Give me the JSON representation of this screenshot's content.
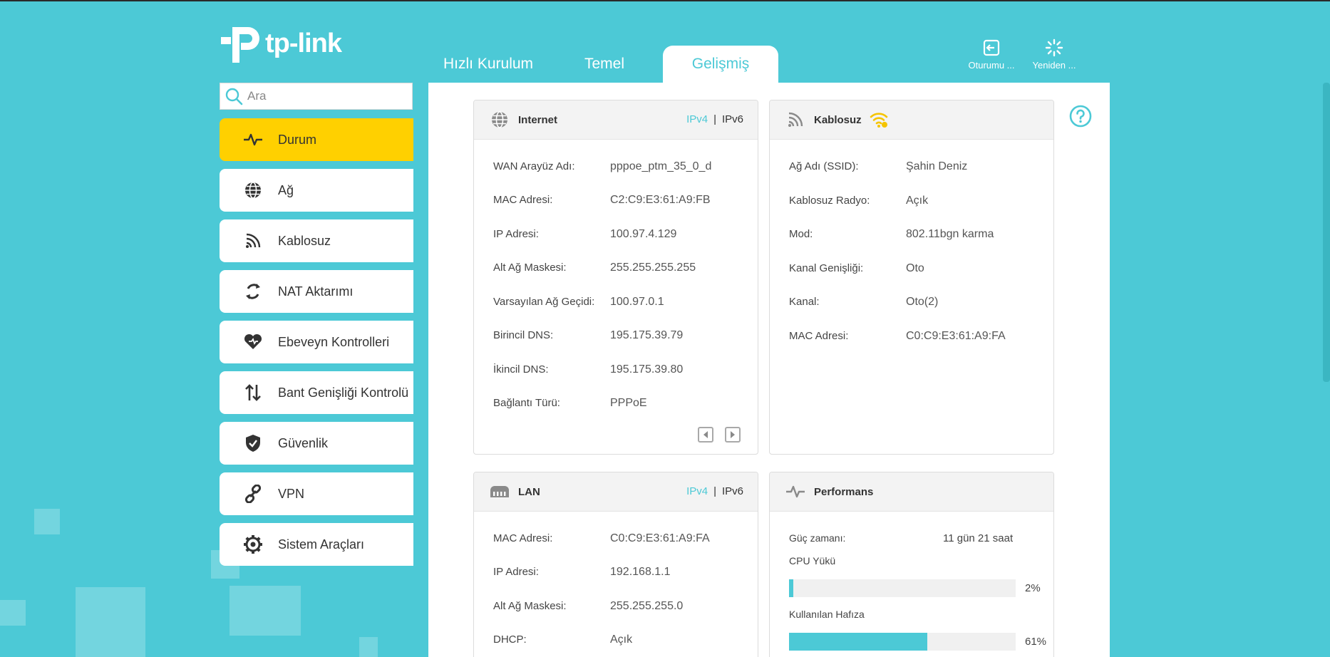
{
  "brand": {
    "logo_text": "tp-link"
  },
  "tabs": [
    {
      "label": "Hızlı Kurulum"
    },
    {
      "label": "Temel"
    },
    {
      "label": "Gelişmiş"
    }
  ],
  "top_actions": {
    "logout": {
      "label": "Oturumu ...",
      "icon": "logout-icon"
    },
    "reboot": {
      "label": "Yeniden ...",
      "icon": "reboot-icon"
    }
  },
  "search": {
    "placeholder": "Ara"
  },
  "sidebar": {
    "items": [
      {
        "label": "Durum",
        "icon": "pulse-icon"
      },
      {
        "label": "Ağ",
        "icon": "globe-icon"
      },
      {
        "label": "Kablosuz",
        "icon": "wireless-icon"
      },
      {
        "label": "NAT Aktarımı",
        "icon": "nat-icon"
      },
      {
        "label": "Ebeveyn Kontrolleri",
        "icon": "heart-icon"
      },
      {
        "label": "Bant Genişliği Kontrolü",
        "icon": "bandwidth-icon"
      },
      {
        "label": "Güvenlik",
        "icon": "shield-icon"
      },
      {
        "label": "VPN",
        "icon": "link-icon"
      },
      {
        "label": "Sistem Araçları",
        "icon": "gear-icon"
      }
    ]
  },
  "internet": {
    "title": "Internet",
    "ipv4": "IPv4",
    "sep": "|",
    "ipv6": "IPv6",
    "rows": [
      {
        "k": "WAN Arayüz Adı:",
        "v": "pppoe_ptm_35_0_d"
      },
      {
        "k": "MAC Adresi:",
        "v": "C2:C9:E3:61:A9:FB"
      },
      {
        "k": "IP Adresi:",
        "v": "100.97.4.129"
      },
      {
        "k": "Alt Ağ Maskesi:",
        "v": "255.255.255.255"
      },
      {
        "k": "Varsayılan Ağ Geçidi:",
        "v": "100.97.0.1"
      },
      {
        "k": "Birincil DNS:",
        "v": "195.175.39.79"
      },
      {
        "k": "İkincil DNS:",
        "v": "195.175.39.80"
      },
      {
        "k": "Bağlantı Türü:",
        "v": "PPPoE"
      }
    ]
  },
  "wireless": {
    "title": "Kablosuz",
    "rows": [
      {
        "k": "Ağ Adı (SSID):",
        "v": "Şahin Deniz"
      },
      {
        "k": "Kablosuz Radyo:",
        "v": "Açık"
      },
      {
        "k": "Mod:",
        "v": "802.11bgn karma"
      },
      {
        "k": "Kanal Genişliği:",
        "v": "Oto"
      },
      {
        "k": "Kanal:",
        "v": "Oto(2)"
      },
      {
        "k": "MAC Adresi:",
        "v": "C0:C9:E3:61:A9:FA"
      }
    ]
  },
  "lan": {
    "title": "LAN",
    "ipv4": "IPv4",
    "sep": "|",
    "ipv6": "IPv6",
    "rows": [
      {
        "k": "MAC Adresi:",
        "v": "C0:C9:E3:61:A9:FA"
      },
      {
        "k": "IP Adresi:",
        "v": "192.168.1.1"
      },
      {
        "k": "Alt Ağ Maskesi:",
        "v": "255.255.255.0"
      },
      {
        "k": "DHCP:",
        "v": "Açık"
      }
    ]
  },
  "performance": {
    "title": "Performans",
    "uptime_label": "Güç zamanı:",
    "uptime_value": "11 gün 21 saat",
    "cpu_label": "CPU Yükü",
    "cpu_percent_text": "2%",
    "cpu_percent": 2,
    "mem_label": "Kullanılan Hafıza",
    "mem_percent_text": "61%",
    "mem_percent": 61
  },
  "colors": {
    "brand": "#4cc9d6",
    "active_nav": "#ffd000",
    "wifi_icon": "#f5c400"
  }
}
